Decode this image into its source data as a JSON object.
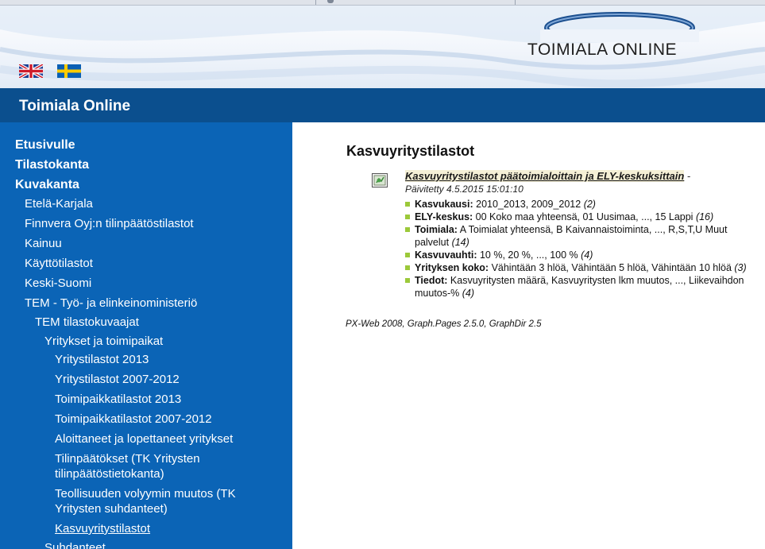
{
  "banner": {
    "logo_text": "TOIMIALA ONLINE",
    "flags": [
      {
        "name": "english-flag"
      },
      {
        "name": "swedish-flag"
      }
    ]
  },
  "header": {
    "title": "Toimiala Online"
  },
  "sidebar": {
    "top_links": [
      "Etusivulle",
      "Tilastokanta",
      "Kuvakanta"
    ],
    "items": [
      {
        "label": "Etelä-Karjala",
        "level": 1
      },
      {
        "label": "Finnvera Oyj:n tilinpäätöstilastot",
        "level": 1
      },
      {
        "label": "Kainuu",
        "level": 1
      },
      {
        "label": "Käyttötilastot",
        "level": 1
      },
      {
        "label": "Keski-Suomi",
        "level": 1
      },
      {
        "label": "TEM - Työ- ja elinkeinoministeriö",
        "level": 1
      },
      {
        "label": "TEM tilastokuvaajat",
        "level": 2
      },
      {
        "label": "Yritykset ja toimipaikat",
        "level": 3
      },
      {
        "label": "Yritystilastot 2013",
        "level": 4
      },
      {
        "label": "Yritystilastot 2007-2012",
        "level": 4
      },
      {
        "label": "Toimipaikkatilastot 2013",
        "level": 4
      },
      {
        "label": "Toimipaikkatilastot 2007-2012",
        "level": 4
      },
      {
        "label": "Aloittaneet ja lopettaneet yritykset",
        "level": 4
      },
      {
        "label": "Tilinpäätökset (TK Yritysten",
        "label2": "tilinpäätöstietokanta)",
        "level": 4
      },
      {
        "label": "Teollisuuden volyymin muutos (TK",
        "label2": "Yritysten suhdanteet)",
        "level": 4
      },
      {
        "label": "Kasvuyritystilastot",
        "level": 4,
        "current": true
      },
      {
        "label": "Suhdanteet",
        "level": 3
      }
    ]
  },
  "main": {
    "heading": "Kasvuyritystilastot",
    "entry": {
      "link_text": "Kasvuyritystilastot päätoimialoittain ja ELY-keskuksittain",
      "dash": " -",
      "updated": "Päivitetty 4.5.2015 15:01:10",
      "variables": [
        {
          "name": "Kasvukausi:",
          "values": " 2010_2013, 2009_2012 ",
          "count": "(2)"
        },
        {
          "name": "ELY-keskus:",
          "values": " 00 Koko maa yhteensä, 01 Uusimaa, ..., 15 Lappi ",
          "count": "(16)"
        },
        {
          "name": "Toimiala:",
          "values": " A Toimialat yhteensä, B Kaivannaistoiminta, ..., R,S,T,U Muut palvelut ",
          "count": "(14)"
        },
        {
          "name": "Kasvuvauhti:",
          "values": " 10 %, 20 %, ..., 100 % ",
          "count": "(4)"
        },
        {
          "name": "Yrityksen koko:",
          "values": " Vähintään 3 hlöä, Vähintään 5 hlöä, Vähintään 10 hlöä ",
          "count": "(3)"
        },
        {
          "name": "Tiedot:",
          "values": " Kasvuyritysten määrä, Kasvuyritysten lkm muutos, ..., Liikevaihdon muutos-% ",
          "count": "(4)"
        }
      ]
    },
    "footer_note": "PX-Web 2008, Graph.Pages 2.5.0, GraphDir 2.5"
  },
  "colors": {
    "header_bar": "#0b4f8e",
    "sidebar_bg": "#0b64b6",
    "bullet": "#9cc93a",
    "link_highlight": "#f5f0d6"
  }
}
